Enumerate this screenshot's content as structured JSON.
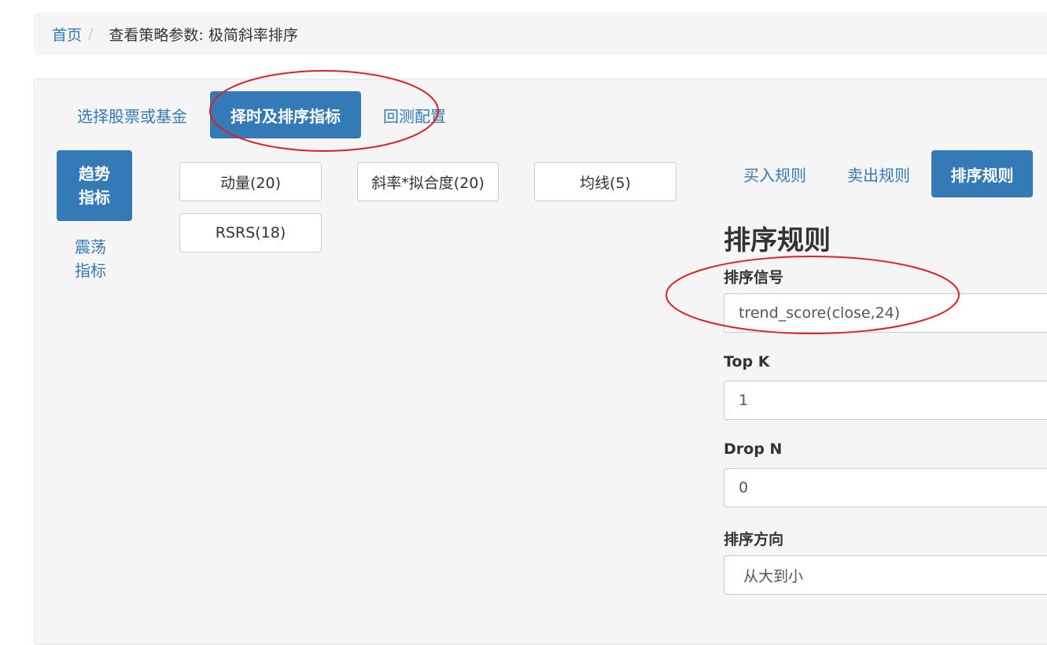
{
  "breadcrumb": {
    "home": "首页",
    "separator": "/",
    "current": "查看策略参数: 极简斜率排序"
  },
  "main_tabs": [
    {
      "label": "选择股票或基金",
      "active": false
    },
    {
      "label": "择时及排序指标",
      "active": true
    },
    {
      "label": "回测配置",
      "active": false
    }
  ],
  "category_tabs": [
    {
      "label_line1": "趋势",
      "label_line2": "指标",
      "active": true
    },
    {
      "label_line1": "震荡",
      "label_line2": "指标",
      "active": false
    }
  ],
  "indicators": [
    {
      "label": "动量(20)"
    },
    {
      "label": "斜率*拟合度(20)"
    },
    {
      "label": "均线(5)"
    },
    {
      "label": "RSRS(18)"
    }
  ],
  "rule_tabs": [
    {
      "label": "买入规则",
      "active": false
    },
    {
      "label": "卖出规则",
      "active": false
    },
    {
      "label": "排序规则",
      "active": true
    }
  ],
  "rule_form": {
    "title": "排序规则",
    "signal_label": "排序信号",
    "signal_value": "trend_score(close,24)",
    "topk_label": "Top K",
    "topk_value": "1",
    "dropn_label": "Drop N",
    "dropn_value": "0",
    "direction_label": "排序方向",
    "direction_value": "从大到小"
  },
  "colors": {
    "primary": "#337ab7",
    "annotation": "#e02020",
    "panel_bg": "#f5f5f5"
  }
}
